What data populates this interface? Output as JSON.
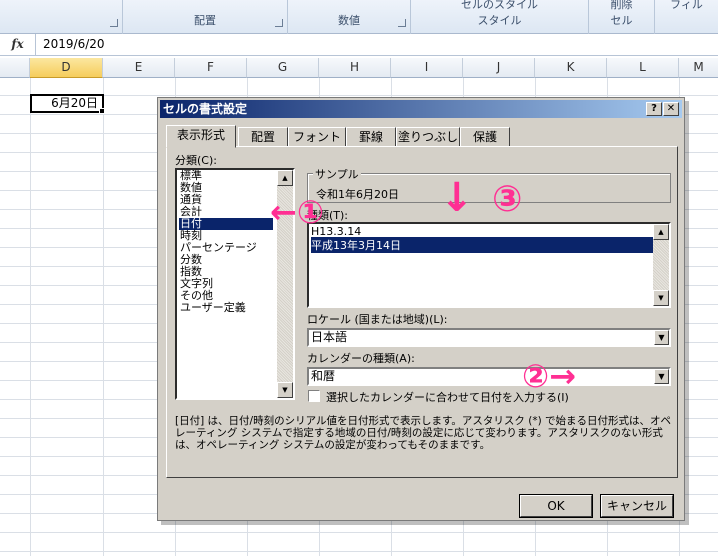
{
  "ribbon": {
    "groups": [
      {
        "label": ""
      },
      {
        "label": "配置"
      },
      {
        "label": "数値"
      },
      {
        "label": "スタイル",
        "top": "セルのスタイル"
      },
      {
        "label": "セル",
        "top": "削除"
      },
      {
        "label": "",
        "top": "フィル"
      }
    ]
  },
  "formula_bar": {
    "fx": "fx",
    "value": "2019/6/20"
  },
  "grid": {
    "columns": [
      "D",
      "E",
      "F",
      "G",
      "H",
      "I",
      "J",
      "K",
      "L",
      "M"
    ],
    "active_cell_value": "6月20日"
  },
  "dialog": {
    "title": "セルの書式設定",
    "help": "?",
    "close": "✕",
    "tabs": [
      "表示形式",
      "配置",
      "フォント",
      "罫線",
      "塗りつぶし",
      "保護"
    ],
    "category_label": "分類(C):",
    "categories": [
      "標準",
      "数値",
      "通貨",
      "会計",
      "日付",
      "時刻",
      "パーセンテージ",
      "分数",
      "指数",
      "文字列",
      "その他",
      "ユーザー定義"
    ],
    "selected_category": "日付",
    "sample_label": "サンプル",
    "sample_value": "令和1年6月20日",
    "type_label": "種類(T):",
    "types": [
      "H13.3.14",
      "平成13年3月14日"
    ],
    "locale_label": "ロケール (国または地域)(L):",
    "locale_value": "日本語",
    "calendar_label": "カレンダーの種類(A):",
    "calendar_value": "和暦",
    "checkbox_label": "選択したカレンダーに合わせて日付を入力する(I)",
    "description": "[日付] は、日付/時刻のシリアル値を日付形式で表示します。アスタリスク (*) で始まる日付形式は、オペレーティング システムで指定する地域の日付/時刻の設定に応じて変わります。アスタリスクのない形式は、オペレーティング システムの設定が変わってもそのままです。",
    "ok": "OK",
    "cancel": "キャンセル"
  },
  "annotations": {
    "a1": "←①",
    "a2": "②→",
    "a3": "③",
    "arrow_down": "↓",
    "color": "#ff2f93"
  }
}
